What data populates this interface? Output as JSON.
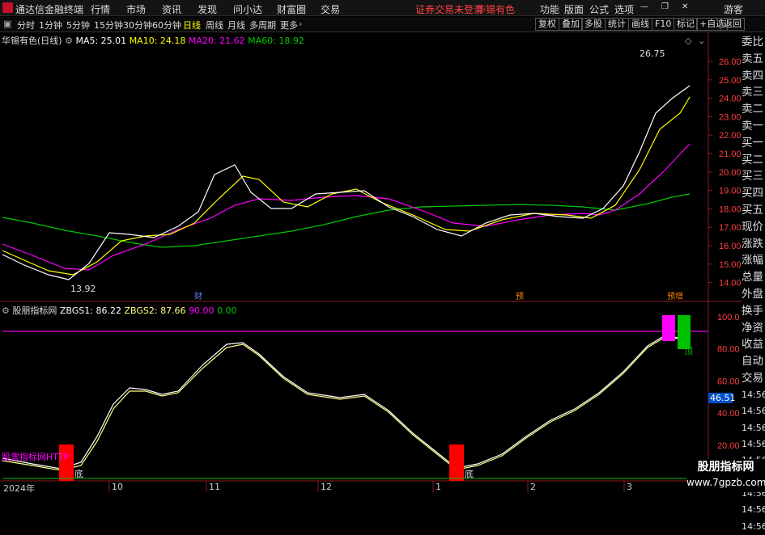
{
  "titlebar": {
    "app_name": "通达信金融终端",
    "menu": [
      "行情",
      "市场",
      "资讯",
      "发现",
      "问小达",
      "财富圈",
      "交易"
    ],
    "notice": "证券交易未登录",
    "stock": "华锡有色",
    "right_menu": [
      "功能",
      "版面",
      "公式",
      "选项"
    ],
    "user": "游客"
  },
  "toolbar": {
    "periods": [
      "分时",
      "1分钟",
      "5分钟",
      "15分钟",
      "30分钟",
      "60分钟",
      "日线",
      "周线",
      "月线",
      "多周期",
      "更多"
    ],
    "active_period": "日线",
    "right_buttons": [
      "复权",
      "叠加",
      "多股",
      "统计",
      "画线",
      "F10",
      "标记",
      "+自选",
      "返回"
    ]
  },
  "main_chart": {
    "title": "华锡有色(日线)",
    "ma": [
      {
        "label": "MA5: 25.01",
        "color": "#ffffff"
      },
      {
        "label": "MA10: 24.18",
        "color": "#ffff00"
      },
      {
        "label": "MA20: 21.62",
        "color": "#ff00ff"
      },
      {
        "label": "MA60: 18.92",
        "color": "#00c800"
      }
    ],
    "y_ticks": [
      "26.00",
      "25.00",
      "24.00",
      "23.00",
      "22.00",
      "21.00",
      "20.00",
      "19.00",
      "18.00",
      "17.00",
      "16.00",
      "15.00",
      "14.00"
    ],
    "high_label": "26.75",
    "low_label": "13.92",
    "event_marks": [
      "财",
      "预",
      "预增"
    ]
  },
  "indicator": {
    "title": "股朋指标网",
    "zbgs1": "ZBGS1: 86.22",
    "zbgs2": "ZBGS2: 87.66",
    "v90": "90.00",
    "v0": "0.00",
    "y_ticks": [
      "100.0",
      "80.00",
      "60.00",
      "40.00",
      "20.00"
    ],
    "current_value": "46.51",
    "bottom_label": "底",
    "top_label": "顶",
    "overlay_text": "股票指标网HTTP"
  },
  "x_axis": [
    "2024年",
    "10",
    "11",
    "12",
    "1",
    "2",
    "3"
  ],
  "side_panel": [
    "委比",
    "卖五",
    "卖四",
    "卖三",
    "卖二",
    "卖一",
    "买一",
    "买二",
    "买三",
    "买四",
    "买五",
    "现价",
    "涨跌",
    "涨幅",
    "总量",
    "外盘",
    "换手",
    "净资",
    "收益",
    "自动",
    "交易",
    "14:56",
    "14:56",
    "14:56",
    "14:56",
    "14:56",
    "14:56",
    "14:56",
    "14:56",
    "14:56"
  ],
  "watermark": {
    "line1": "股朋指标网",
    "line2": "www.7gpzb.com"
  },
  "colors": {
    "up": "#ff3232",
    "down": "#54ffff",
    "ma5": "#ffffff",
    "ma10": "#ffff00",
    "ma20": "#ff00ff",
    "ma60": "#00c800",
    "bottom_bar": "#ff0000",
    "top_bar1": "#ff00ff",
    "top_bar2": "#00c000"
  }
}
